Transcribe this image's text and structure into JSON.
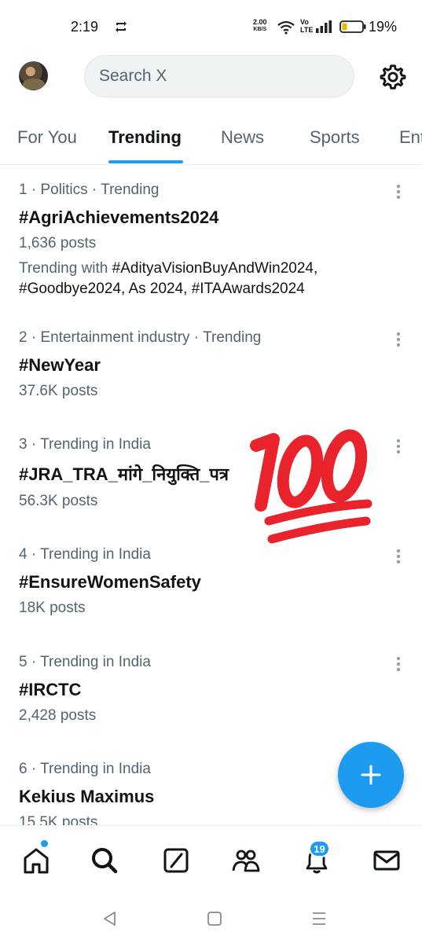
{
  "status_bar": {
    "time": "2:19",
    "net_speed_value": "2.00",
    "net_speed_unit": "KB/S",
    "volte_top": "Vo",
    "volte_bottom": "LTE",
    "battery": "19%"
  },
  "header": {
    "search_placeholder": "Search X"
  },
  "tabs": [
    {
      "label": "For You"
    },
    {
      "label": "Trending"
    },
    {
      "label": "News"
    },
    {
      "label": "Sports"
    },
    {
      "label": "Ent"
    }
  ],
  "trends": [
    {
      "meta": "1 · Politics · Trending",
      "name": "#AgriAchievements2024",
      "count": "1,636 posts",
      "with_prefix": "Trending with ",
      "with_tags": "#AdityaVisionBuyAndWin2024, #Goodbye2024, As 2024, #ITAAwards2024"
    },
    {
      "meta": "2 · Entertainment industry · Trending",
      "name": "#NewYear",
      "count": "37.6K posts"
    },
    {
      "meta": "3 · Trending in India",
      "name": "#JRA_TRA_मांगे_नियुक्ति_पत्र",
      "count": "56.3K posts"
    },
    {
      "meta": "4 · Trending in India",
      "name": "#EnsureWomenSafety",
      "count": "18K posts"
    },
    {
      "meta": "5 · Trending in India",
      "name": "#IRCTC",
      "count": "2,428 posts"
    },
    {
      "meta": "6 · Trending in India",
      "name": "Kekius Maximus",
      "count": "15.5K posts"
    }
  ],
  "bottom_nav": {
    "notifications_badge": "19"
  },
  "colors": {
    "accent": "#1d9bf0",
    "text_primary": "#0f1419",
    "text_secondary": "#536471"
  },
  "icons": {
    "sync": "sync-icon",
    "wifi": "wifi-icon",
    "signal": "signal-icon",
    "battery": "battery-icon",
    "settings": "gear-icon",
    "more": "more-vertical-icon",
    "compose": "plus-icon",
    "home": "home-icon",
    "search": "search-icon",
    "grok": "grok-icon",
    "communities": "communities-icon",
    "notifications": "bell-icon",
    "messages": "mail-icon",
    "emoji": "hundred-points-emoji"
  }
}
